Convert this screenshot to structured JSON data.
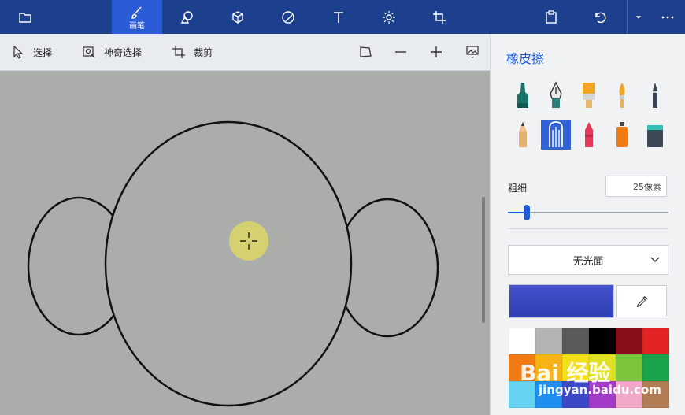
{
  "topbar": {
    "active_tab_label": "画笔"
  },
  "toolbar": {
    "select_label": "选择",
    "magic_select_label": "神奇选择",
    "crop_label": "裁剪"
  },
  "panel": {
    "title": "橡皮擦",
    "brushes": [
      {
        "name": "calligraphy-pen",
        "selected": false
      },
      {
        "name": "fountain-pen",
        "selected": false
      },
      {
        "name": "oil-brush",
        "selected": false
      },
      {
        "name": "watercolor-brush",
        "selected": false
      },
      {
        "name": "marker",
        "selected": false
      },
      {
        "name": "pencil",
        "selected": false
      },
      {
        "name": "eraser",
        "selected": true
      },
      {
        "name": "crayon",
        "selected": false
      },
      {
        "name": "spray-can",
        "selected": false
      },
      {
        "name": "fill-bucket",
        "selected": false
      }
    ],
    "size_label": "粗细",
    "size_value": "25像素",
    "size_fraction": 0.12,
    "finish_value": "无光面",
    "current_color": "#4452cc",
    "palette": [
      "#ffffff",
      "#b4b4b4",
      "#5a5a5a",
      "#000000",
      "#8a0f1c",
      "#e32323",
      "#f07b14",
      "#f6b416",
      "#f2e01a",
      "#e1e123",
      "#7cc63c",
      "#1aa34a",
      "#64d2f0",
      "#1e8ff0",
      "#3b48c8",
      "#a23cc8",
      "#f2a6c8",
      "#b27c55"
    ]
  },
  "watermark": {
    "text": "Bai 经验",
    "url": "jingyan.baidu.com"
  }
}
